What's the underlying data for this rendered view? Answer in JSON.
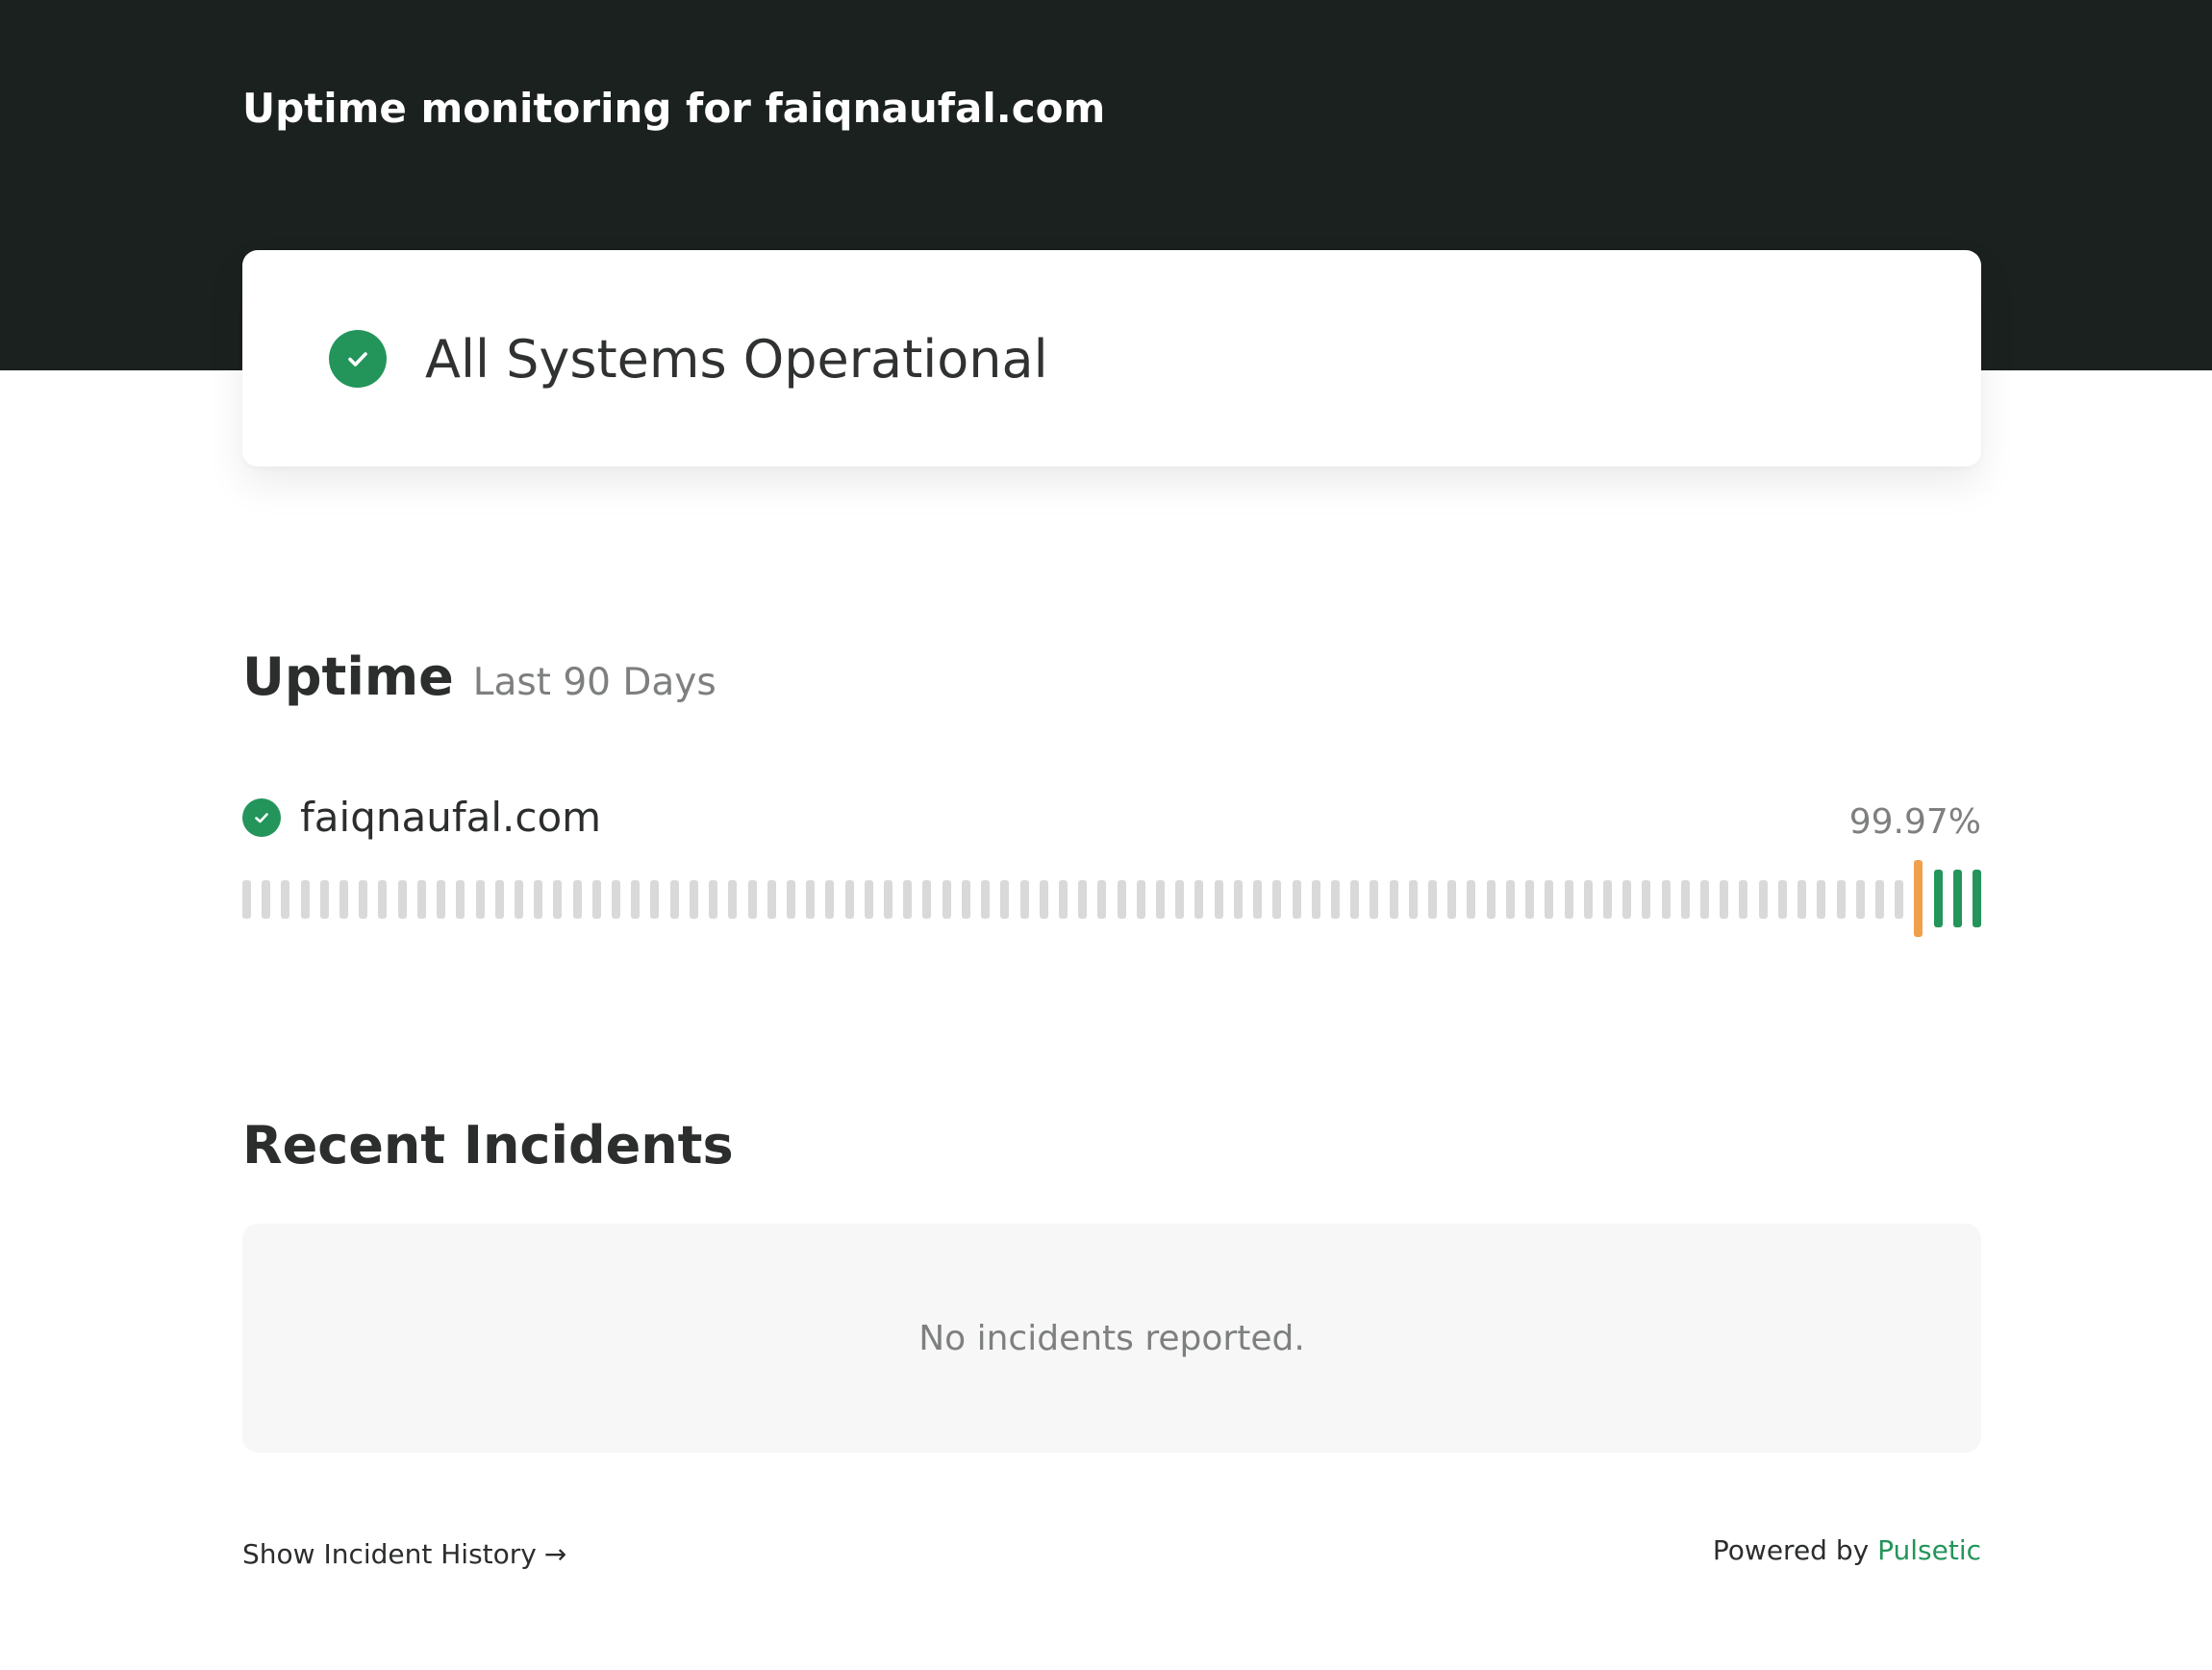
{
  "header": {
    "title": "Uptime monitoring for faiqnaufal.com"
  },
  "status": {
    "text": "All Systems Operational",
    "icon": "check-circle-icon",
    "color": "#23955a"
  },
  "uptime": {
    "title": "Uptime",
    "subtitle": "Last 90 Days",
    "monitor": {
      "name": "faiqnaufal.com",
      "percentage": "99.97%",
      "icon": "check-circle-icon"
    },
    "day_statuses": [
      "none",
      "none",
      "none",
      "none",
      "none",
      "none",
      "none",
      "none",
      "none",
      "none",
      "none",
      "none",
      "none",
      "none",
      "none",
      "none",
      "none",
      "none",
      "none",
      "none",
      "none",
      "none",
      "none",
      "none",
      "none",
      "none",
      "none",
      "none",
      "none",
      "none",
      "none",
      "none",
      "none",
      "none",
      "none",
      "none",
      "none",
      "none",
      "none",
      "none",
      "none",
      "none",
      "none",
      "none",
      "none",
      "none",
      "none",
      "none",
      "none",
      "none",
      "none",
      "none",
      "none",
      "none",
      "none",
      "none",
      "none",
      "none",
      "none",
      "none",
      "none",
      "none",
      "none",
      "none",
      "none",
      "none",
      "none",
      "none",
      "none",
      "none",
      "none",
      "none",
      "none",
      "none",
      "none",
      "none",
      "none",
      "none",
      "none",
      "none",
      "none",
      "none",
      "none",
      "none",
      "none",
      "none",
      "partial",
      "up",
      "up",
      "up"
    ],
    "colors": {
      "none": "#d9d9d9",
      "up": "#23955a",
      "partial": "#f0a04b"
    }
  },
  "incidents": {
    "title": "Recent Incidents",
    "empty_message": "No incidents reported."
  },
  "footer": {
    "history_link": "Show Incident History",
    "history_arrow": "→",
    "powered_prefix": "Powered by",
    "powered_brand": "Pulsetic"
  }
}
